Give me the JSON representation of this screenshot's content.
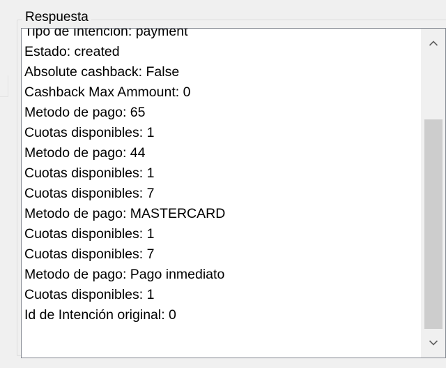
{
  "group": {
    "legend": "Respuesta"
  },
  "response_lines": [
    "Tipo de Intención: payment",
    "Estado: created",
    "Absolute cashback: False",
    "Cashback Max Ammount: 0",
    "Metodo de pago: 65",
    "Cuotas disponibles: 1",
    "Metodo de pago: 44",
    "Cuotas disponibles: 1",
    "Cuotas disponibles: 7",
    "Metodo de pago: MASTERCARD",
    "Cuotas disponibles: 1",
    "Cuotas disponibles: 7",
    "Metodo de pago: Pago inmediato",
    "Cuotas disponibles: 1",
    "Id de Intención original: 0"
  ],
  "scrollbar": {
    "up_icon": "chevron-up-icon",
    "down_icon": "chevron-down-icon",
    "thumb_color": "#cdcdcd"
  }
}
